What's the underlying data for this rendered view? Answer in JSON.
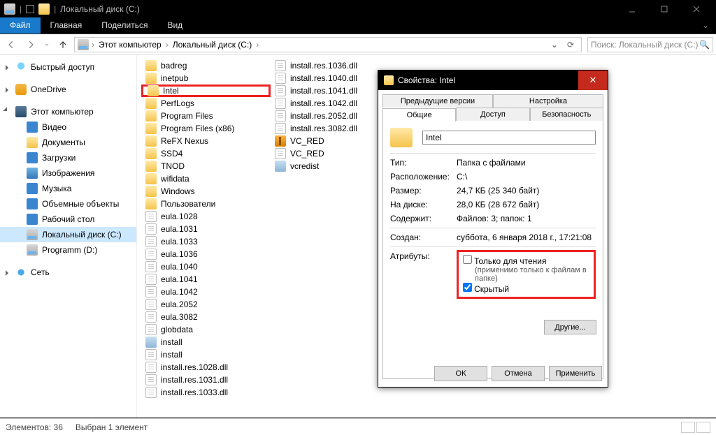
{
  "window_title": "Локальный диск (C:)",
  "ribbon": {
    "file": "Файл",
    "tabs": [
      "Главная",
      "Поделиться",
      "Вид"
    ]
  },
  "breadcrumb": {
    "pc": "Этот компьютер",
    "drive": "Локальный диск (C:)"
  },
  "search_placeholder": "Поиск: Локальный диск (C:)",
  "sidebar": {
    "quick": "Быстрый доступ",
    "onedrive": "OneDrive",
    "thispc": "Этот компьютер",
    "children": [
      "Видео",
      "Документы",
      "Загрузки",
      "Изображения",
      "Музыка",
      "Объемные объекты",
      "Рабочий стол"
    ],
    "drive_c": "Локальный диск (C:)",
    "drive_d": "Programm (D:)",
    "network": "Сеть"
  },
  "col1": [
    "badreg",
    "inetpub",
    "Intel",
    "PerfLogs",
    "Program Files",
    "Program Files (x86)",
    "ReFX Nexus",
    "SSD4",
    "TNOD",
    "wifidata",
    "Windows",
    "Пользователи",
    "eula.1028",
    "eula.1031",
    "eula.1033",
    "eula.1036",
    "eula.1040",
    "eula.1041",
    "eula.1042",
    "eula.2052",
    "eula.3082",
    "globdata",
    "install",
    "install",
    "install.res.1028.dll",
    "install.res.1031.dll",
    "install.res.1033.dll"
  ],
  "col1_types": [
    "folder",
    "folder",
    "folder",
    "folder",
    "folder",
    "folder",
    "folder",
    "folder",
    "folder",
    "folder",
    "folder",
    "folder",
    "file",
    "file",
    "file",
    "file",
    "file",
    "file",
    "file",
    "file",
    "file",
    "file",
    "exe",
    "file",
    "file",
    "file",
    "file"
  ],
  "col2": [
    "install.res.1036.dll",
    "install.res.1040.dll",
    "install.res.1041.dll",
    "install.res.1042.dll",
    "install.res.2052.dll",
    "install.res.3082.dll",
    "VC_RED",
    "VC_RED",
    "vcredist"
  ],
  "col2_types": [
    "file",
    "file",
    "file",
    "file",
    "file",
    "file",
    "arch",
    "file",
    "exe"
  ],
  "highlighted": "Intel",
  "status": {
    "count": "Элементов: 36",
    "sel": "Выбран 1 элемент"
  },
  "dlg": {
    "title": "Свойства: Intel",
    "tabs_row1": [
      "Предыдущие версии",
      "Настройка"
    ],
    "tabs_row2": [
      "Общие",
      "Доступ",
      "Безопасность"
    ],
    "name": "Intel",
    "type_k": "Тип:",
    "type_v": "Папка с файлами",
    "loc_k": "Расположение:",
    "loc_v": "C:\\",
    "size_k": "Размер:",
    "size_v": "24,7 КБ (25 340 байт)",
    "disk_k": "На диске:",
    "disk_v": "28,0 КБ (28 672 байт)",
    "cont_k": "Содержит:",
    "cont_v": "Файлов: 3; папок: 1",
    "created_k": "Создан:",
    "created_v": "суббота, 6 января 2018 г., 17:21:08",
    "attr_k": "Атрибуты:",
    "readonly": "Только для чтения",
    "readonly_hint": "(применимо только к файлам в папке)",
    "hidden": "Скрытый",
    "other": "Другие...",
    "ok": "ОК",
    "cancel": "Отмена",
    "apply": "Применить"
  }
}
